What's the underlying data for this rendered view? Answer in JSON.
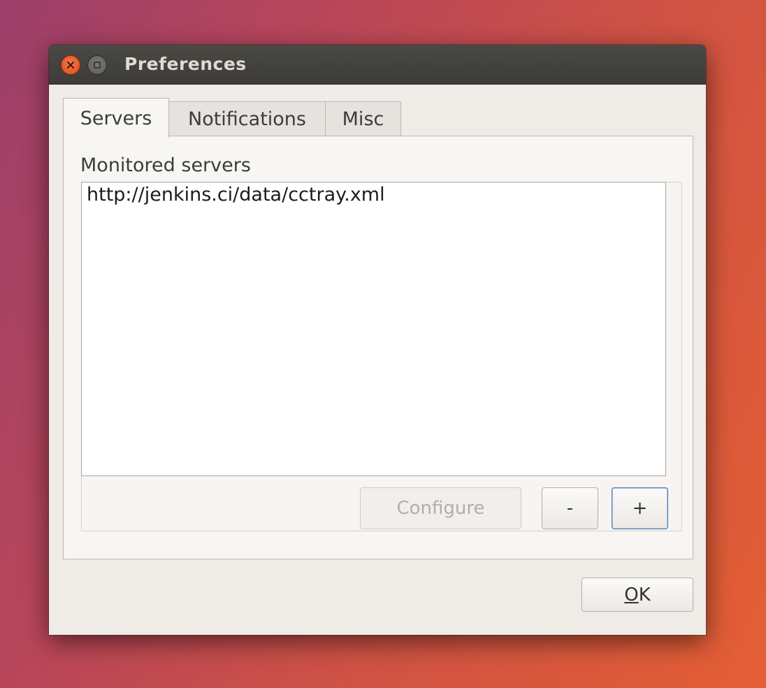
{
  "window": {
    "title": "Preferences"
  },
  "tabs": [
    {
      "label": "Servers",
      "selected": true
    },
    {
      "label": "Notifications",
      "selected": false
    },
    {
      "label": "Misc",
      "selected": false
    }
  ],
  "servers": {
    "section_label": "Monitored servers",
    "items": [
      "http://jenkins.ci/data/cctray.xml"
    ],
    "configure_label": "Configure",
    "configure_enabled": false,
    "remove_label": "-",
    "add_label": "+"
  },
  "footer": {
    "ok_mnemonic": "O",
    "ok_rest": "K"
  },
  "colors": {
    "close_button": "#df4a1c",
    "focus_border": "#4f7fb0"
  },
  "icons": {
    "close": "close-icon",
    "maximize": "maximize-icon"
  }
}
